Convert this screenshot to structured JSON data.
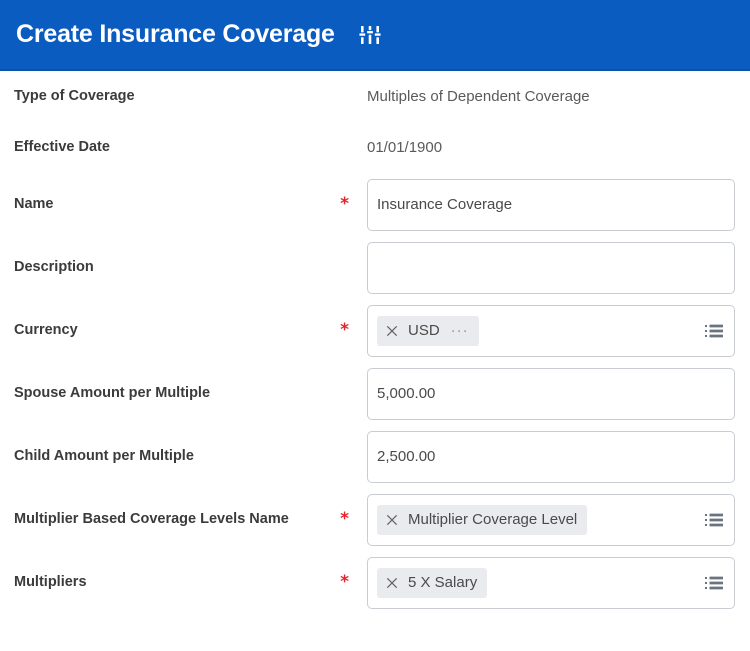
{
  "header": {
    "title": "Create Insurance Coverage",
    "settings_icon": "sliders-icon"
  },
  "form": {
    "required_marker": "*",
    "rows": [
      {
        "label": "Type of Coverage",
        "required": false,
        "type": "static",
        "value": "Multiples of Dependent Coverage"
      },
      {
        "label": "Effective Date",
        "required": false,
        "type": "static",
        "value": "01/01/1900"
      },
      {
        "label": "Name",
        "required": true,
        "type": "text",
        "value": "Insurance Coverage",
        "placeholder": ""
      },
      {
        "label": "Description",
        "required": false,
        "type": "text",
        "value": "",
        "placeholder": ""
      },
      {
        "label": "Currency",
        "required": true,
        "type": "multiselect",
        "pill": "USD",
        "pill_has_ellipsis": true,
        "ellipsis": "···",
        "list_icon": "list-icon"
      },
      {
        "label": "Spouse Amount per Multiple",
        "required": false,
        "type": "text",
        "value": "5,000.00",
        "placeholder": ""
      },
      {
        "label": "Child Amount per Multiple",
        "required": false,
        "type": "text",
        "value": "2,500.00",
        "placeholder": ""
      },
      {
        "label": "Multiplier Based Coverage Levels Name",
        "required": true,
        "type": "multiselect",
        "pill": "Multiplier Coverage Level",
        "pill_has_ellipsis": false,
        "list_icon": "list-icon"
      },
      {
        "label": "Multipliers",
        "required": true,
        "type": "multiselect",
        "pill": "5 X Salary",
        "pill_has_ellipsis": false,
        "list_icon": "list-icon"
      }
    ]
  },
  "colors": {
    "header_blue": "#0b5cc0",
    "header_blue_border": "#0a53ad",
    "required_red": "#e8222a",
    "label_text": "#3b3b3b",
    "value_text": "#4a4a4a",
    "input_border": "#c9ccd1",
    "pill_bg": "#e9ebee"
  }
}
